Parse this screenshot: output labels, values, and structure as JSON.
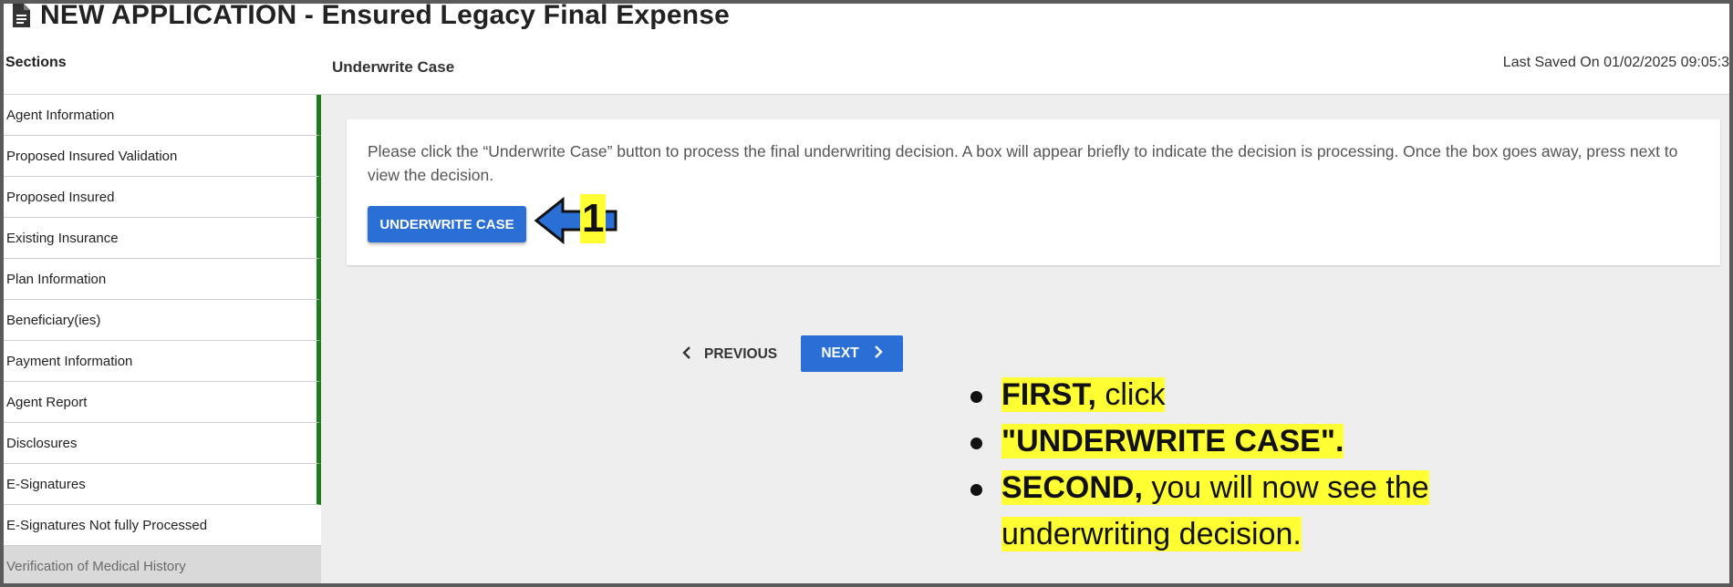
{
  "header": {
    "title": "NEW APPLICATION - Ensured Legacy Final Expense"
  },
  "sidebar": {
    "title": "Sections",
    "items": [
      {
        "label": "Agent Information",
        "state": "complete"
      },
      {
        "label": "Proposed Insured Validation",
        "state": "complete"
      },
      {
        "label": "Proposed Insured",
        "state": "complete"
      },
      {
        "label": "Existing Insurance",
        "state": "complete"
      },
      {
        "label": "Plan Information",
        "state": "complete"
      },
      {
        "label": "Beneficiary(ies)",
        "state": "complete"
      },
      {
        "label": "Payment Information",
        "state": "complete"
      },
      {
        "label": "Agent Report",
        "state": "complete"
      },
      {
        "label": "Disclosures",
        "state": "complete"
      },
      {
        "label": "E-Signatures",
        "state": "complete"
      },
      {
        "label": "E-Signatures Not fully Processed",
        "state": "current"
      },
      {
        "label": "Verification of Medical History",
        "state": "disabled"
      }
    ]
  },
  "main": {
    "section_title": "Underwrite Case",
    "last_saved": "Last Saved On 01/02/2025 09:05:3",
    "instructions": "Please click the “Underwrite Case” button to process the final underwriting decision. A box will appear briefly to indicate the decision is processing. Once the box goes away, press next to view the decision.",
    "underwrite_button": "UNDERWRITE CASE",
    "previous_button": "PREVIOUS",
    "next_button": "NEXT"
  },
  "annotation": {
    "step_number": "1",
    "bullet1_bold": "FIRST,",
    "bullet1_rest": " click",
    "bullet2": "\"UNDERWRITE CASE\".",
    "bullet3_bold": "SECOND,",
    "bullet3_rest": " you will now see the underwriting decision."
  },
  "colors": {
    "accent": "#2a6fd6",
    "complete_bar": "#1e7b1e",
    "highlight": "#ffff33"
  }
}
